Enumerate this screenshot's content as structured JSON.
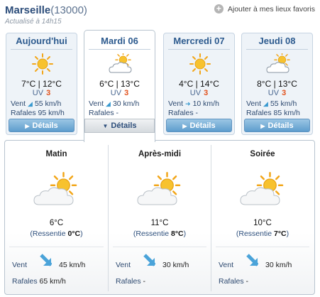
{
  "header": {
    "city": "Marseille",
    "postal_code": "(13000)",
    "updated": "Actualisé à 14h15",
    "favorite_label": "Ajouter à mes lieux favoris"
  },
  "days": [
    {
      "name": "Aujourd'hui",
      "icon": "sun-icon",
      "temps": "7°C | 12°C",
      "uv_label": "UV",
      "uv": "3",
      "wind_label": "Vent",
      "wind": "55 km/h",
      "gust_label": "Rafales",
      "gust": "95 km/h",
      "details": "Détails",
      "active": false
    },
    {
      "name": "Mardi 06",
      "icon": "sun-cloud-icon",
      "temps": "6°C | 13°C",
      "uv_label": "UV",
      "uv": "3",
      "wind_label": "Vent",
      "wind": "30 km/h",
      "gust_label": "Rafales",
      "gust": "-",
      "details": "Détails",
      "active": true
    },
    {
      "name": "Mercredi 07",
      "icon": "sun-icon",
      "temps": "4°C | 14°C",
      "uv_label": "UV",
      "uv": "3",
      "wind_label": "Vent",
      "wind": "10 km/h",
      "gust_label": "Rafales",
      "gust": "-",
      "details": "Détails",
      "active": false
    },
    {
      "name": "Jeudi 08",
      "icon": "sun-cloud-icon",
      "temps": "8°C | 13°C",
      "uv_label": "UV",
      "uv": "3",
      "wind_label": "Vent",
      "wind": "55 km/h",
      "gust_label": "Rafales",
      "gust": "85 km/h",
      "details": "Détails",
      "active": false
    }
  ],
  "periods": [
    {
      "name": "Matin",
      "icon": "sun-cloud-icon",
      "temp": "6°C",
      "feel_prefix": "(Ressentie ",
      "feel": "0°C",
      "feel_suffix": ")",
      "wind_label": "Vent",
      "wind": "45 km/h",
      "gust_label": "Rafales",
      "gust": "65 km/h"
    },
    {
      "name": "Après-midi",
      "icon": "sun-cloud-icon",
      "temp": "11°C",
      "feel_prefix": "(Ressentie ",
      "feel": "8°C",
      "feel_suffix": ")",
      "wind_label": "Vent",
      "wind": "30 km/h",
      "gust_label": "Rafales",
      "gust": "-"
    },
    {
      "name": "Soirée",
      "icon": "sun-cloud-icon",
      "temp": "10°C",
      "feel_prefix": "(Ressentie ",
      "feel": "7°C",
      "feel_suffix": ")",
      "wind_label": "Vent",
      "wind": "30 km/h",
      "gust_label": "Rafales",
      "gust": "-"
    }
  ],
  "colors": {
    "brand_blue": "#2c4d7a",
    "uv_orange": "#e2521d",
    "button_blue": "#5e9dcd",
    "sun_yellow": "#f7c22e"
  }
}
